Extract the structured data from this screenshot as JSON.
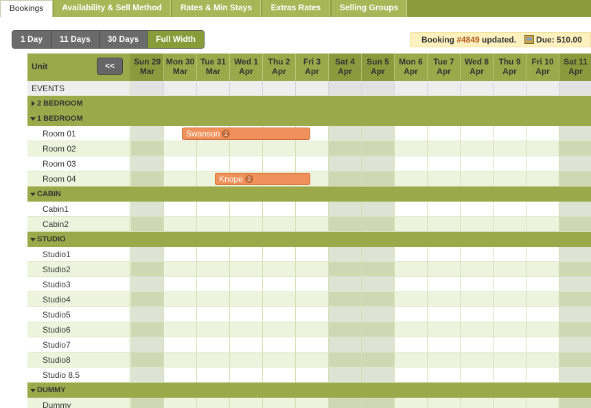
{
  "tabs": [
    {
      "label": "Bookings",
      "active": true
    },
    {
      "label": "Availability & Sell Method",
      "active": false
    },
    {
      "label": "Rates & Min Stays",
      "active": false
    },
    {
      "label": "Extras Rates",
      "active": false
    },
    {
      "label": "Selling Groups",
      "active": false
    }
  ],
  "view_buttons": [
    {
      "label": "1 Day",
      "active": false
    },
    {
      "label": "11 Days",
      "active": false
    },
    {
      "label": "30 Days",
      "active": false
    },
    {
      "label": "Full Width",
      "active": true
    }
  ],
  "status": {
    "prefix": "Booking ",
    "booking_number": "#4849",
    "suffix": " updated.",
    "due_label": "Due: 510.00"
  },
  "grid": {
    "unit_header": "Unit",
    "collapse_label": "<<",
    "days": [
      {
        "line1": "Sun 29",
        "line2": "Mar",
        "weekend": true
      },
      {
        "line1": "Mon 30",
        "line2": "Mar",
        "weekend": false
      },
      {
        "line1": "Tue 31",
        "line2": "Mar",
        "weekend": false
      },
      {
        "line1": "Wed 1",
        "line2": "Apr",
        "weekend": false
      },
      {
        "line1": "Thu 2",
        "line2": "Apr",
        "weekend": false
      },
      {
        "line1": "Fri 3",
        "line2": "Apr",
        "weekend": false
      },
      {
        "line1": "Sat 4",
        "line2": "Apr",
        "weekend": true
      },
      {
        "line1": "Sun 5",
        "line2": "Apr",
        "weekend": true
      },
      {
        "line1": "Mon 6",
        "line2": "Apr",
        "weekend": false
      },
      {
        "line1": "Tue 7",
        "line2": "Apr",
        "weekend": false
      },
      {
        "line1": "Wed 8",
        "line2": "Apr",
        "weekend": false
      },
      {
        "line1": "Thu 9",
        "line2": "Apr",
        "weekend": false
      },
      {
        "line1": "Fri 10",
        "line2": "Apr",
        "weekend": false
      },
      {
        "line1": "Sat 11",
        "line2": "Apr",
        "weekend": true
      }
    ],
    "rows": [
      {
        "type": "events",
        "label": "EVENTS"
      },
      {
        "type": "group",
        "label": "2 BEDROOM",
        "expanded": false
      },
      {
        "type": "group",
        "label": "1 BEDROOM",
        "expanded": true
      },
      {
        "type": "unit",
        "label": "Room 01"
      },
      {
        "type": "unit",
        "label": "Room 02"
      },
      {
        "type": "unit",
        "label": "Room 03"
      },
      {
        "type": "unit",
        "label": "Room 04"
      },
      {
        "type": "group",
        "label": "CABIN",
        "expanded": true
      },
      {
        "type": "unit",
        "label": "Cabin1"
      },
      {
        "type": "unit",
        "label": "Cabin2"
      },
      {
        "type": "group",
        "label": "STUDIO",
        "expanded": true
      },
      {
        "type": "unit",
        "label": "Studio1"
      },
      {
        "type": "unit",
        "label": "Studio2"
      },
      {
        "type": "unit",
        "label": "Studio3"
      },
      {
        "type": "unit",
        "label": "Studio4"
      },
      {
        "type": "unit",
        "label": "Studio5"
      },
      {
        "type": "unit",
        "label": "Studio6"
      },
      {
        "type": "unit",
        "label": "Studio7"
      },
      {
        "type": "unit",
        "label": "Studio8"
      },
      {
        "type": "unit",
        "label": "Studio 8.5"
      },
      {
        "type": "group",
        "label": "DUMMY",
        "expanded": true
      },
      {
        "type": "unit",
        "label": "Dummy"
      }
    ],
    "bookings": [
      {
        "guest": "Swanson",
        "guests_count": "2",
        "unit": "Room 01",
        "start_day": "Mon 30 Mar",
        "end_day": "Fri 3 Apr"
      },
      {
        "guest": "Knope",
        "guests_count": "2",
        "unit": "Room 04",
        "start_day": "Tue 31 Mar",
        "end_day": "Fri 3 Apr"
      }
    ]
  },
  "colors": {
    "header_green": "#9aaa4a",
    "tab_green": "#a7b758",
    "booking_orange": "#f0905a",
    "status_bg": "#fdf1bf"
  }
}
